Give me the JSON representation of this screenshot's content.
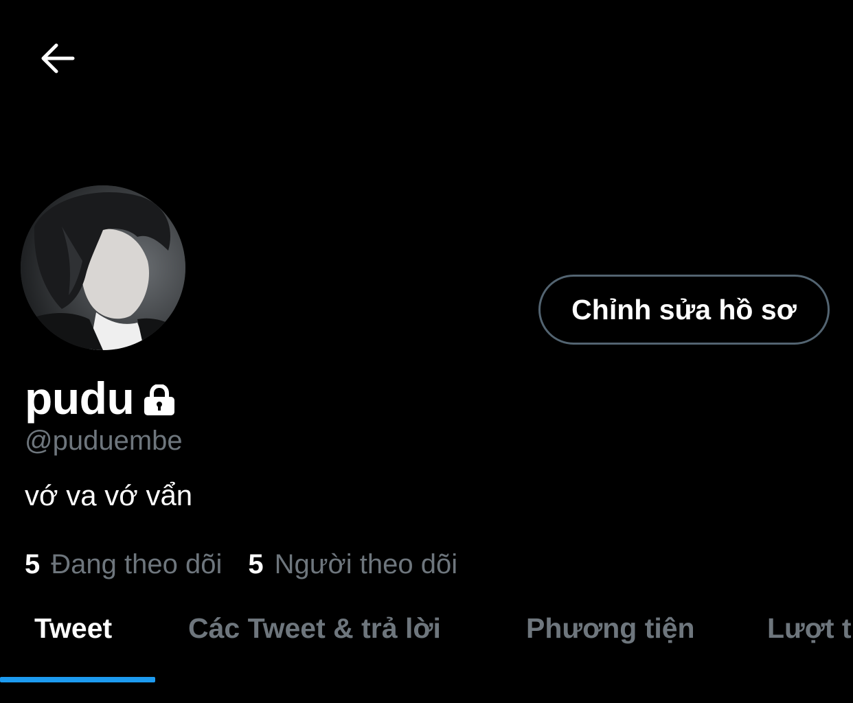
{
  "header": {
    "back_icon": "arrow-left-icon"
  },
  "profile": {
    "display_name": "pudu",
    "lock_icon": "lock-icon",
    "handle": "@puduembe",
    "bio": "vớ va vớ vẩn",
    "edit_button_label": "Chỉnh sửa hồ sơ"
  },
  "stats": {
    "following_count": "5",
    "following_label": "Đang theo dõi",
    "followers_count": "5",
    "followers_label": "Người theo dõi"
  },
  "tabs": [
    {
      "label": "Tweet",
      "active": true
    },
    {
      "label": "Các Tweet & trả lời",
      "active": false
    },
    {
      "label": "Phương tiện",
      "active": false
    },
    {
      "label": "Lượt thích",
      "active": false
    }
  ],
  "colors": {
    "background": "#000000",
    "accent": "#1d9bf0",
    "muted_text": "#6e767d",
    "button_border": "#536471"
  }
}
